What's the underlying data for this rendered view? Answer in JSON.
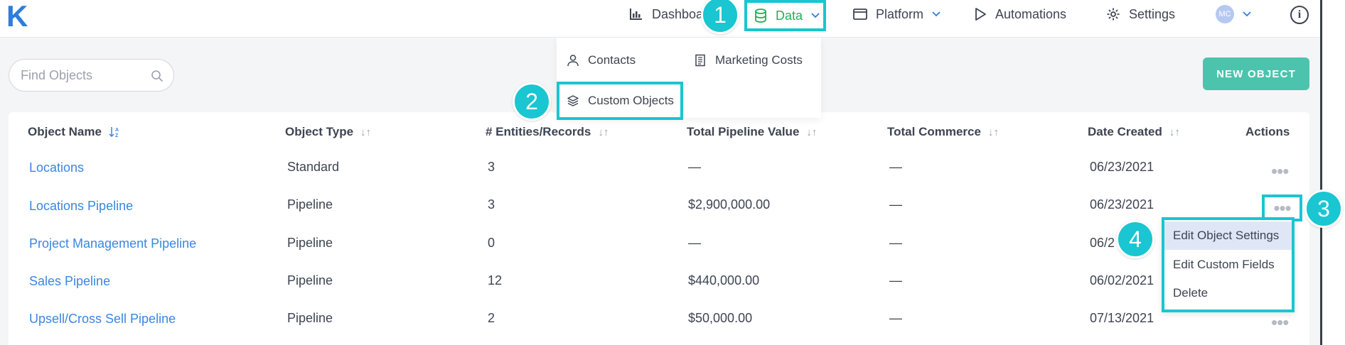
{
  "header": {
    "logo": "K",
    "nav": {
      "dashboards": "Dashboards",
      "data": "Data",
      "platform": "Platform",
      "automations": "Automations",
      "settings": "Settings",
      "avatar_initials": "MC",
      "info": "i"
    }
  },
  "data_menu": {
    "contacts": "Contacts",
    "marketing_costs": "Marketing Costs",
    "custom_objects": "Custom Objects"
  },
  "search": {
    "placeholder": "Find Objects"
  },
  "new_object_button": "NEW OBJECT",
  "table": {
    "columns": [
      "Object Name",
      "Object Type",
      "# Entities/Records",
      "Total Pipeline Value",
      "Total Commerce",
      "Date Created",
      "Actions"
    ],
    "rows": [
      {
        "name": "Locations",
        "type": "Standard",
        "records": "3",
        "pipeline_value": "—",
        "commerce": "—",
        "date": "06/23/2021"
      },
      {
        "name": "Locations Pipeline",
        "type": "Pipeline",
        "records": "3",
        "pipeline_value": "$2,900,000.00",
        "commerce": "—",
        "date": "06/23/2021"
      },
      {
        "name": "Project Management Pipeline",
        "type": "Pipeline",
        "records": "0",
        "pipeline_value": "—",
        "commerce": "—",
        "date": "06/2"
      },
      {
        "name": "Sales Pipeline",
        "type": "Pipeline",
        "records": "12",
        "pipeline_value": "$440,000.00",
        "commerce": "—",
        "date": "06/02/2021"
      },
      {
        "name": "Upsell/Cross Sell Pipeline",
        "type": "Pipeline",
        "records": "2",
        "pipeline_value": "$50,000.00",
        "commerce": "—",
        "date": "07/13/2021"
      }
    ],
    "actions_glyph": "•••"
  },
  "actions_menu": {
    "items": [
      "Edit Object Settings",
      "Edit Custom Fields",
      "Delete"
    ]
  },
  "steps": [
    "1",
    "2",
    "3",
    "4"
  ],
  "colors": {
    "brand": "#2e7ddc",
    "accent_green": "#19b45a",
    "highlight": "#19c6d1",
    "new_button": "#4cc4ad",
    "link": "#3a86e0"
  }
}
